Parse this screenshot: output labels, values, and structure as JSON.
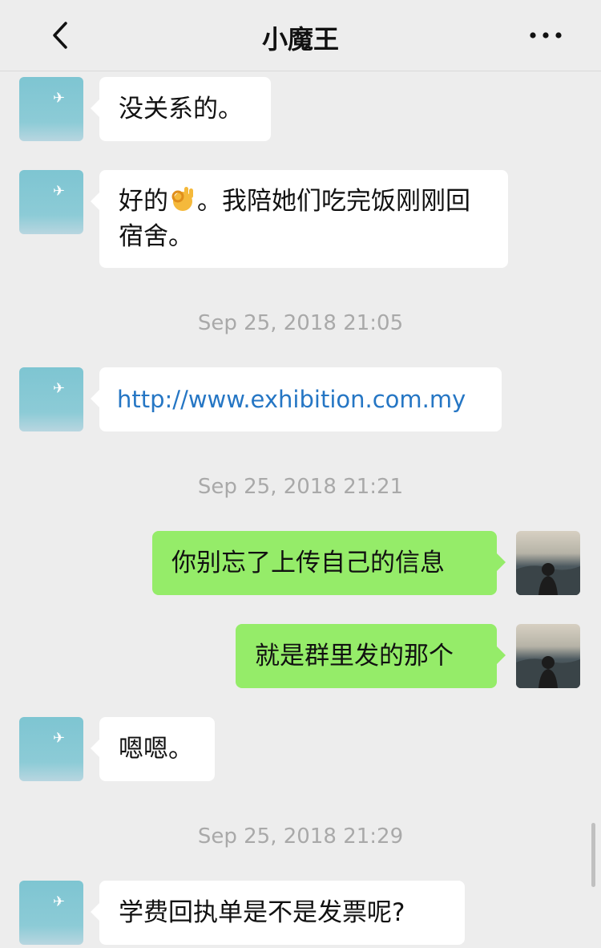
{
  "header": {
    "title": "小魔王",
    "back_icon": "chevron-left-icon",
    "more_icon": "more-dots-icon"
  },
  "colors": {
    "background": "#ededed",
    "bubble_left": "#ffffff",
    "bubble_right": "#95ec69",
    "link": "#2576c4",
    "timestamp": "#a9a9a9"
  },
  "messages": [
    {
      "sender": "other",
      "text": "没关系的。"
    },
    {
      "sender": "other",
      "text_before": "好的",
      "emoji": "ok-hand-emoji",
      "text_after": "。我陪她们吃完饭刚刚回宿舍。"
    },
    {
      "type": "timestamp",
      "text": "Sep 25, 2018 21:05"
    },
    {
      "sender": "other",
      "text": "http://www.exhibition.com.my",
      "is_link": true
    },
    {
      "type": "timestamp",
      "text": "Sep 25, 2018 21:21"
    },
    {
      "sender": "me",
      "text": "你别忘了上传自己的信息"
    },
    {
      "sender": "me",
      "text": "就是群里发的那个"
    },
    {
      "sender": "other",
      "text": "嗯嗯。"
    },
    {
      "type": "timestamp",
      "text": "Sep 25, 2018 21:29"
    },
    {
      "sender": "other",
      "text": "学费回执单是不是发票呢?"
    }
  ]
}
